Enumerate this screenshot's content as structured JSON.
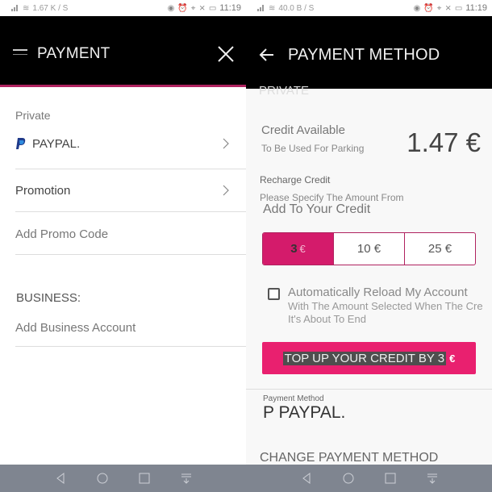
{
  "left": {
    "status": {
      "speed": "1.67 K / S",
      "time": "11:19"
    },
    "header": {
      "title": "PAYMENT",
      "card_icon": "card-icon",
      "close_icon": "close-icon"
    },
    "private_label": "Private",
    "paypal": {
      "icon": "paypal-icon",
      "label": "PAYPAL."
    },
    "promotion": "Promotion",
    "promo_code": "Add Promo Code",
    "business_label": "BUSINESS:",
    "add_business": "Add Business Account"
  },
  "right": {
    "status": {
      "speed": "40.0 B / S",
      "time": "11:19"
    },
    "header": {
      "title": "PAYMENT METHOD",
      "back_icon": "arrow-left-icon",
      "tab": "PRIVATE"
    },
    "credit": {
      "label": "Credit Available",
      "sub": "To Be Used For Parking",
      "value": "1.47 €"
    },
    "recharge": {
      "label": "Recharge Credit",
      "sub1": "Please Specify The Amount From",
      "sub2": "Add To Your Credit"
    },
    "amounts": [
      {
        "value": "3",
        "currency": "€",
        "selected": true
      },
      {
        "label": "10 €"
      },
      {
        "label": "25 €"
      }
    ],
    "auto_reload": {
      "checked": false,
      "line1": "Automatically Reload My Account",
      "line2": "With The Amount Selected When The Cre",
      "line3": "It's About To End"
    },
    "topup": {
      "label": "TOP UP YOUR CREDIT BY 3",
      "currency": "€"
    },
    "payment_method": {
      "label": "Payment Method",
      "value": "P PAYPAL."
    },
    "change_method": "CHANGE PAYMENT METHOD"
  },
  "colors": {
    "accent": "#d41b6b",
    "button": "#e9206f",
    "header": "#000000",
    "navbar": "#7f8590"
  }
}
